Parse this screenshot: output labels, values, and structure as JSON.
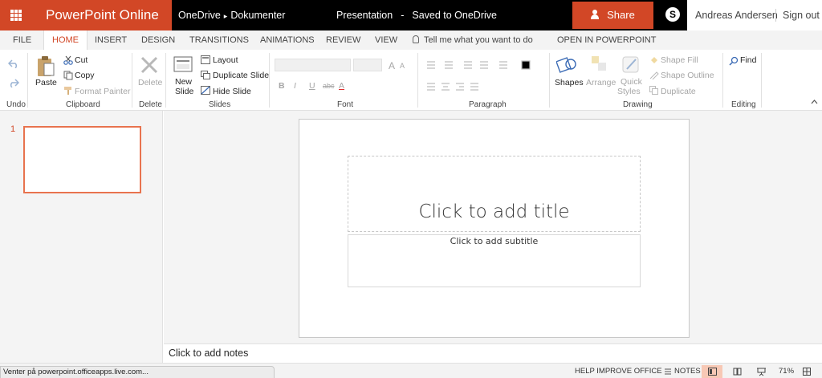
{
  "topbar": {
    "app_name": "PowerPoint Online",
    "breadcrumb": {
      "location": "OneDrive",
      "folder": "Dokumenter",
      "separator": "▸"
    },
    "doc_name": "Presentation",
    "doc_dash": "-",
    "save_status": "Saved to OneDrive",
    "share_label": "Share",
    "skype_letter": "S",
    "user_name": "Andreas Andersen",
    "signout_label": "Sign out"
  },
  "tabs": {
    "file": "FILE",
    "home": "HOME",
    "insert": "INSERT",
    "design": "DESIGN",
    "transitions": "TRANSITIONS",
    "animations": "ANIMATIONS",
    "review": "REVIEW",
    "view": "VIEW",
    "tell_me": "Tell me what you want to do",
    "open_in_app": "OPEN IN POWERPOINT",
    "active": "HOME"
  },
  "ribbon": {
    "undo_group": "Undo",
    "clipboard": {
      "group": "Clipboard",
      "paste": "Paste",
      "cut": "Cut",
      "copy": "Copy",
      "format_painter": "Format Painter"
    },
    "delete": {
      "group": "Delete",
      "button": "Delete"
    },
    "slides": {
      "group": "Slides",
      "new_slide_line1": "New",
      "new_slide_line2": "Slide",
      "layout": "Layout",
      "duplicate": "Duplicate Slide",
      "hide": "Hide Slide"
    },
    "font": {
      "group": "Font",
      "bold": "B",
      "italic": "I",
      "underline": "U",
      "strike": "abc",
      "font_color": "A",
      "grow": "A",
      "shrink": "A"
    },
    "paragraph": {
      "group": "Paragraph"
    },
    "drawing": {
      "group": "Drawing",
      "shapes": "Shapes",
      "arrange": "Arrange",
      "quick_styles_line1": "Quick",
      "quick_styles_line2": "Styles",
      "shape_fill": "Shape Fill",
      "shape_outline": "Shape Outline",
      "duplicate": "Duplicate"
    },
    "editing": {
      "group": "Editing",
      "find": "Find"
    }
  },
  "slide_pane": {
    "slide_number": "1"
  },
  "slide": {
    "title_placeholder": "Click to add title",
    "subtitle_placeholder": "Click to add subtitle"
  },
  "notes": {
    "placeholder": "Click to add notes"
  },
  "statusbar": {
    "loading_text": "Venter på powerpoint.officeapps.live.com...",
    "help_improve": "HELP IMPROVE OFFICE",
    "notes_label": "NOTES",
    "zoom": "71%"
  },
  "colors": {
    "accent": "#d24726",
    "share": "#d24726",
    "thumb_border": "#e8734e"
  }
}
